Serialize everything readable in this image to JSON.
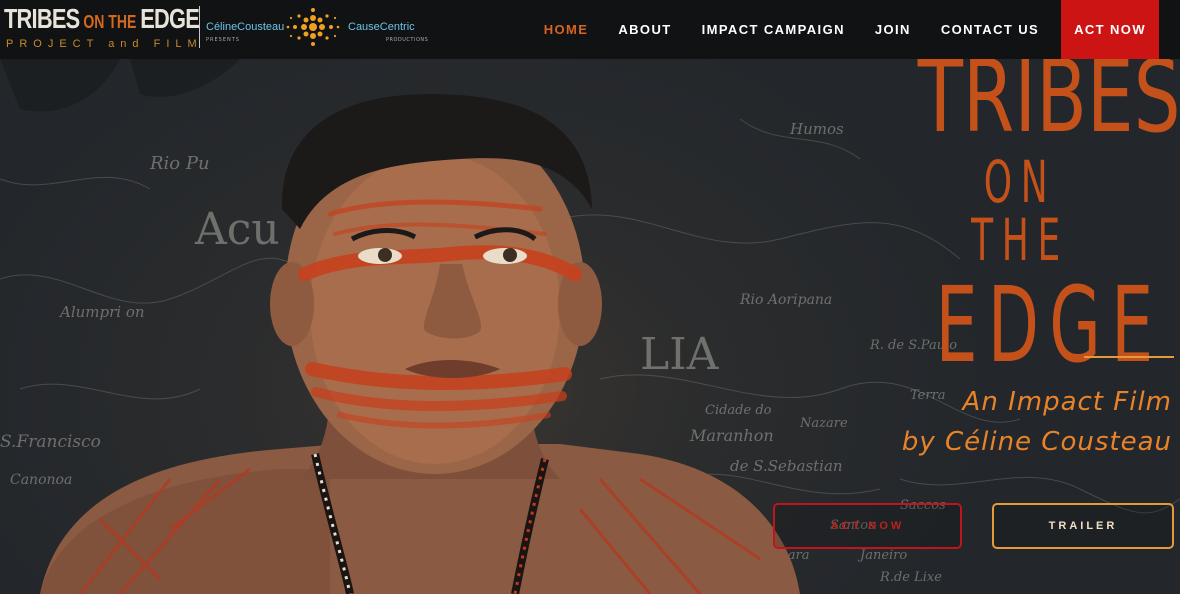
{
  "header": {
    "logo": {
      "title_part1": "TRIBES",
      "title_small": " ON THE ",
      "title_part2": "EDGE",
      "subtitle": "PROJECT and FILM",
      "partner1": "CélineCousteau",
      "partner1_sub": "PRESENTS",
      "partner2": "CauseCentric",
      "partner2_sub": "PRODUCTIONS"
    },
    "nav": [
      {
        "label": "HOME",
        "active": true
      },
      {
        "label": "ABOUT"
      },
      {
        "label": "IMPACT CAMPAIGN"
      },
      {
        "label": "JOIN"
      },
      {
        "label": "CONTACT US"
      },
      {
        "label": "ACT NOW",
        "cta": true
      }
    ]
  },
  "hero": {
    "title_line1": "TRIBES",
    "title_line2": "ON THE",
    "title_line3": "EDGE",
    "tagline_line1": "An Impact Film",
    "tagline_line2": "by Céline Cousteau",
    "map_labels": [
      "Humos",
      "Rio Aoripana",
      "LIA",
      "Cidade do",
      "Maranhon",
      "de S.Sebastian",
      "S.Francisco",
      "Canonoa",
      "Alumpri on",
      "Rio Pu",
      "Acu",
      "R. de S.Paulo",
      "Terra",
      "Nazare",
      "Santos",
      "Janeiro",
      "R.de Lixe",
      "Saccos",
      "Siera do Lara"
    ],
    "buttons": {
      "act_now": "ACT NOW",
      "trailer": "TRAILER"
    },
    "colors": {
      "accent_orange": "#c4511a",
      "tagline": "#e8832a",
      "cta_red": "#cc1414",
      "trailer_border": "#e49a3a"
    }
  }
}
